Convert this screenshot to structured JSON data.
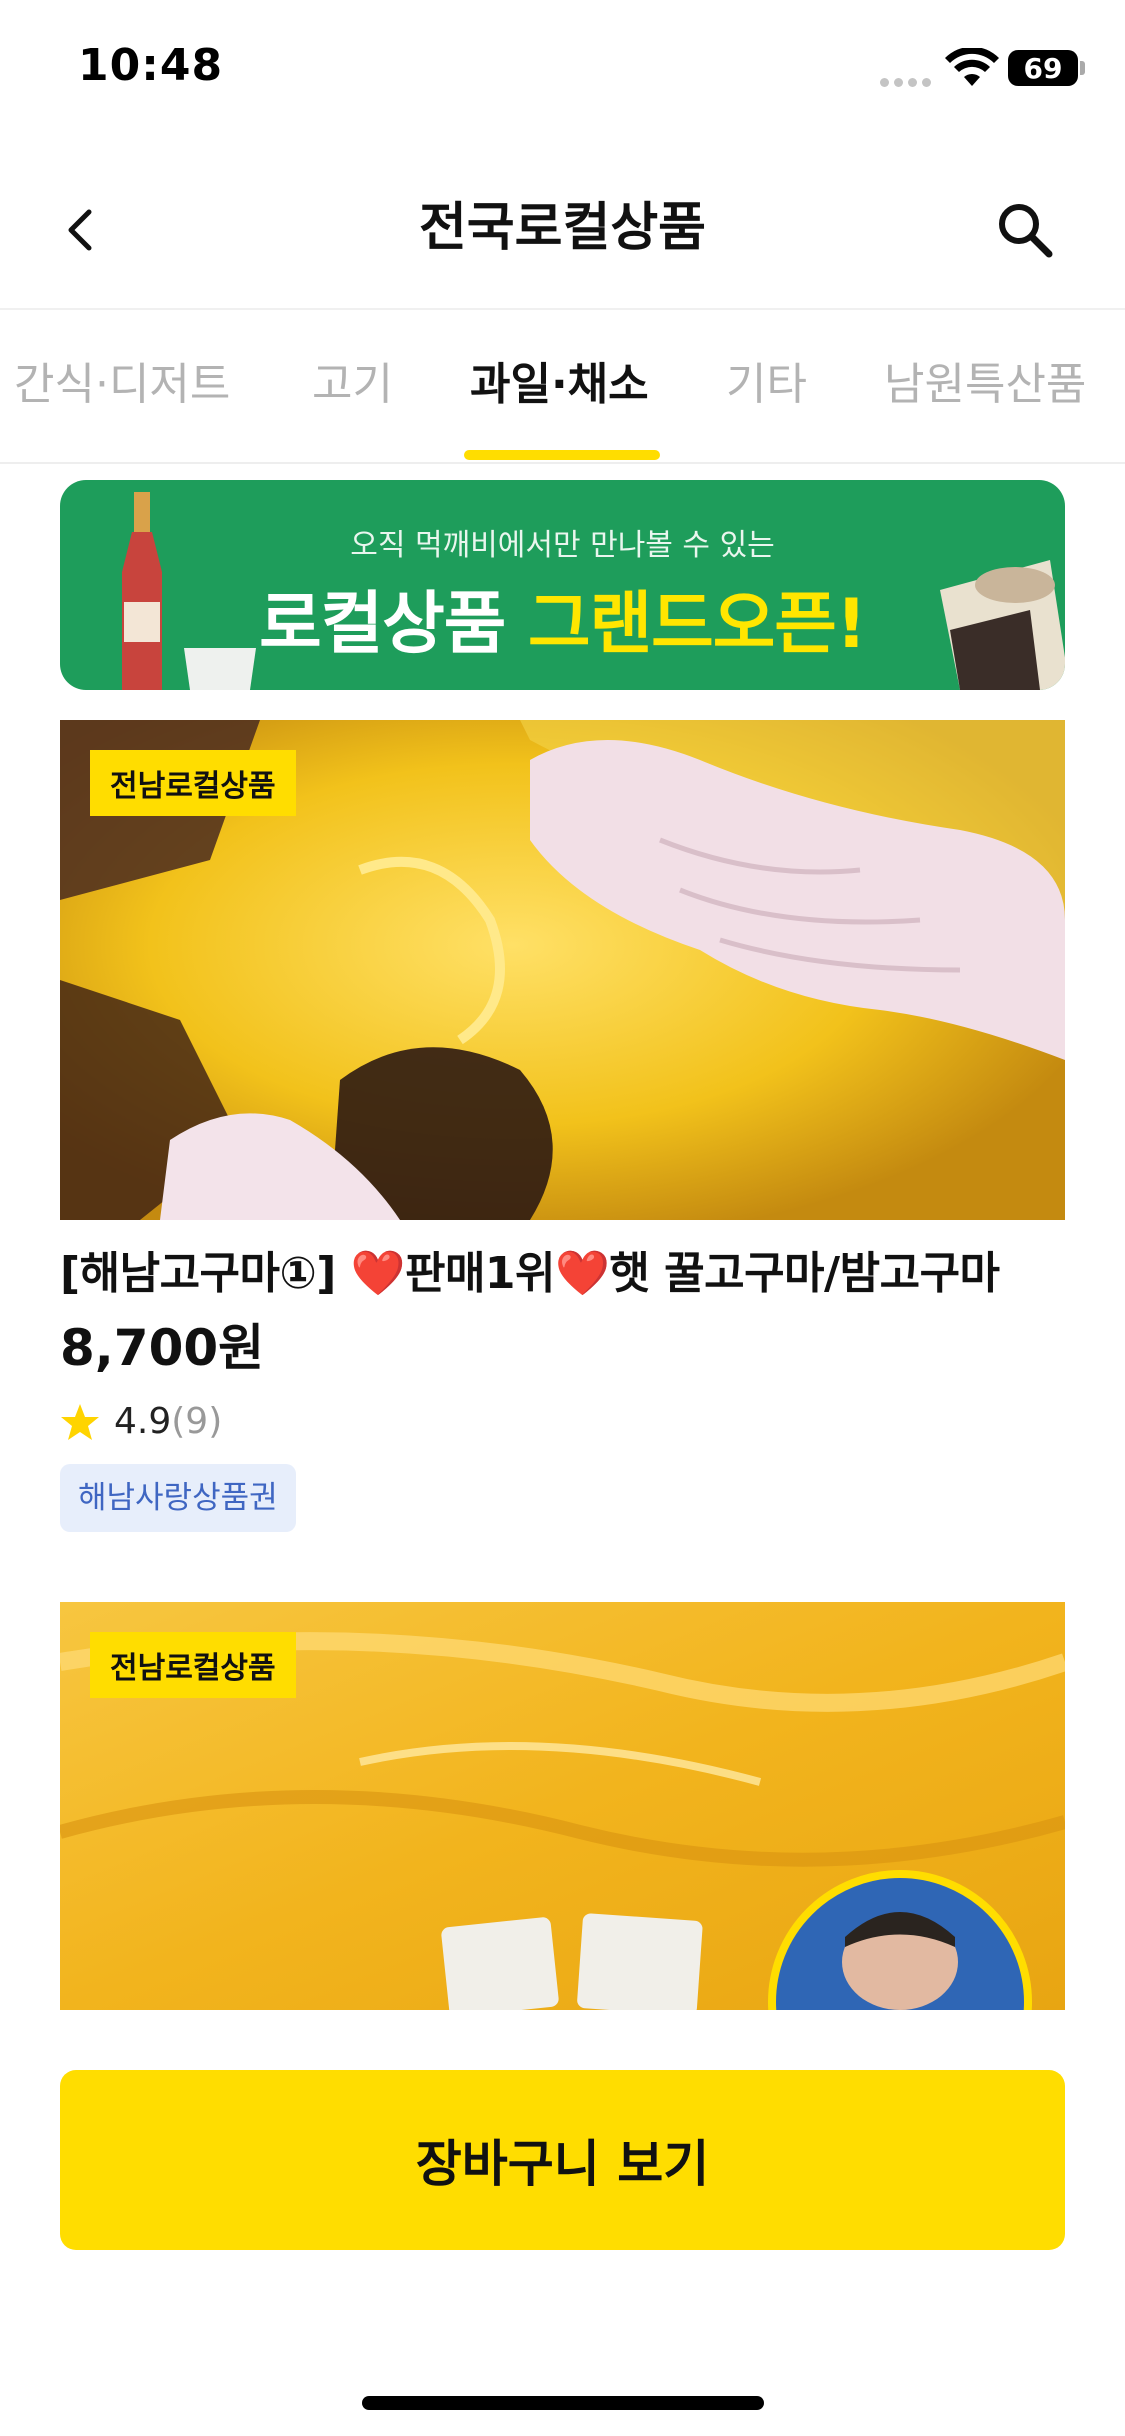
{
  "status_bar": {
    "time": "10:48",
    "battery": "69",
    "icons": [
      "signal-dots-icon",
      "wifi-icon",
      "battery-icon"
    ]
  },
  "header": {
    "title": "전국로컬상품",
    "back_icon": "chevron-left-icon",
    "search_icon": "search-icon"
  },
  "tabs": {
    "items": [
      "간식·디저트",
      "고기",
      "과일·채소",
      "기타",
      "남원특산품"
    ],
    "active_index": 2
  },
  "banner": {
    "subtitle": "오직 먹깨비에서만 만나볼 수 있는",
    "title_main": "로컬상품 ",
    "title_highlight": "그랜드오픈!"
  },
  "products": [
    {
      "badge": "전남로컬상품",
      "title": "[해남고구마①] ❤️판매1위❤️햇 꿀고구마/밤고구마",
      "price": "8,700원",
      "rating": "4.9",
      "review_count": "(9)",
      "tag": "해남사랑상품권"
    },
    {
      "badge": "전남로컬상품"
    }
  ],
  "cart_button": {
    "label": "장바구니 보기"
  },
  "colors": {
    "accent_yellow": "#ffdd00",
    "banner_green": "#1e9d5b",
    "tag_blue": "#3f66c2",
    "inactive_tab": "#b3b3b3"
  }
}
